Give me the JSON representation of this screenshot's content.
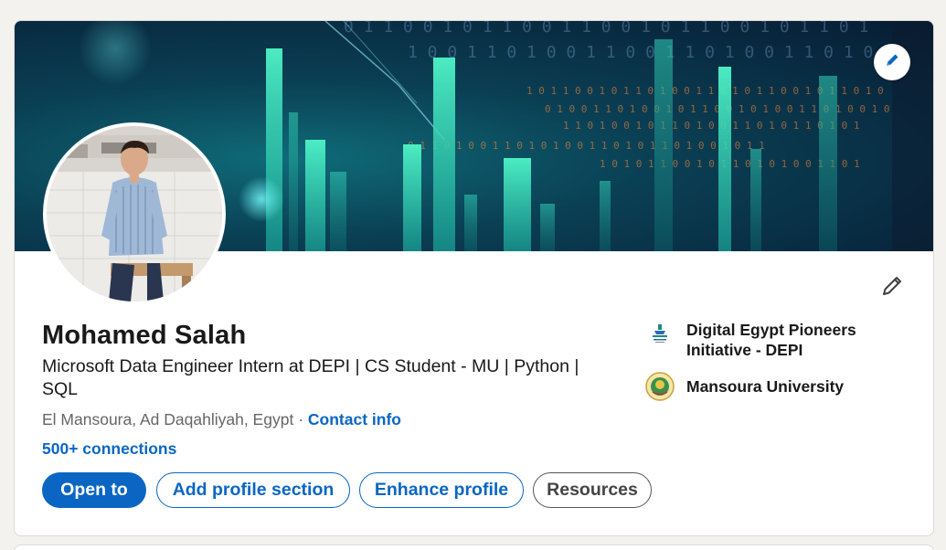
{
  "profile": {
    "name": "Mohamed Salah",
    "headline": "Microsoft Data Engineer Intern at DEPI | CS Student - MU | Python | SQL",
    "location": "El Mansoura, Ad Daqahliyah, Egypt",
    "separator": "·",
    "contact_info": "Contact info",
    "connections": "500+ connections"
  },
  "buttons": {
    "open_to": "Open to",
    "add_section": "Add profile section",
    "enhance": "Enhance profile",
    "resources": "Resources"
  },
  "affiliations": [
    {
      "name": "Digital Egypt Pioneers Initiative - DEPI",
      "icon": "depi-logo"
    },
    {
      "name": "Mansoura University",
      "icon": "mansoura-university-logo"
    }
  ],
  "icons": {
    "banner_edit": "pencil-icon",
    "intro_edit": "pencil-icon"
  },
  "colors": {
    "accent": "#0a66c2",
    "page_bg": "#f4f2ee",
    "banner_teal": "#2ee6b8"
  }
}
